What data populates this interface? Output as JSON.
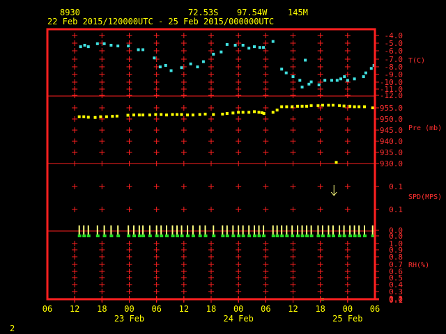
{
  "header": {
    "station": "8930",
    "lat": "72.53S",
    "lon": "97.54W",
    "elev": "145M",
    "period": "22 Feb 2015/120000UTC - 25 Feb 2015/000000UTC"
  },
  "footer": {
    "page": "2"
  },
  "colors": {
    "frame": "#ff2020",
    "label": "#ff3030",
    "text": "#ffff00",
    "temp": "#40e0e0",
    "pres": "#ffff00",
    "rh_line": "#ffff80",
    "rh_dot": "#22dd22",
    "wind": "#ffff80"
  },
  "chart_data": {
    "type": "scatter",
    "x_ticks": [
      "06",
      "12",
      "18",
      "00",
      "06",
      "12",
      "18",
      "00",
      "06",
      "12",
      "18",
      "00",
      "06"
    ],
    "date_labels": [
      "23 Feb",
      "24 Feb",
      "25 Feb"
    ],
    "panels": [
      {
        "name": "T(C)",
        "ticks": [
          "-4.0",
          "-5.0",
          "-6.0",
          "-7.0",
          "-8.0",
          "-9.0",
          "-10.0",
          "-11.0",
          "-12.0"
        ],
        "ylim": [
          -12,
          -4
        ],
        "points": [
          [
            13.3,
            -5.5
          ],
          [
            14.2,
            -5.3
          ],
          [
            15.0,
            -5.5
          ],
          [
            17.0,
            -5.1
          ],
          [
            18.5,
            -5.1
          ],
          [
            20.0,
            -5.3
          ],
          [
            21.5,
            -5.4
          ],
          [
            23.8,
            -5.4
          ],
          [
            26.0,
            -5.9
          ],
          [
            27.0,
            -5.9
          ],
          [
            29.5,
            -7.0
          ],
          [
            30.8,
            -8.2
          ],
          [
            32.0,
            -8.0
          ],
          [
            33.2,
            -8.7
          ],
          [
            35.5,
            -8.3
          ],
          [
            37.5,
            -7.8
          ],
          [
            39.0,
            -8.2
          ],
          [
            40.3,
            -7.5
          ],
          [
            42.5,
            -6.5
          ],
          [
            44.2,
            -6.2
          ],
          [
            45.5,
            -5.2
          ],
          [
            47.3,
            -5.3
          ],
          [
            49.0,
            -5.3
          ],
          [
            50.3,
            -5.7
          ],
          [
            51.5,
            -5.5
          ],
          [
            52.7,
            -5.6
          ],
          [
            53.5,
            -5.6
          ],
          [
            55.6,
            -4.8
          ],
          [
            57.5,
            -8.5
          ],
          [
            58.5,
            -9.0
          ],
          [
            60.0,
            -9.5
          ],
          [
            61.5,
            -10.0
          ],
          [
            62.0,
            -10.9
          ],
          [
            62.7,
            -7.3
          ],
          [
            63.5,
            -10.5
          ],
          [
            64.0,
            -10.2
          ],
          [
            65.7,
            -10.6
          ],
          [
            67.0,
            -10.0
          ],
          [
            68.5,
            -10.0
          ],
          [
            69.7,
            -10.0
          ],
          [
            70.5,
            -9.8
          ],
          [
            71.3,
            -9.5
          ],
          [
            72.0,
            -10.0
          ],
          [
            73.5,
            -9.8
          ],
          [
            75.5,
            -9.5
          ],
          [
            76.0,
            -9.0
          ],
          [
            77.2,
            -8.4
          ],
          [
            77.8,
            -8.0
          ]
        ]
      },
      {
        "name": "Pre (mb)",
        "ticks": [
          "955.0",
          "950.0",
          "945.0",
          "940.0",
          "935.0",
          "930.0"
        ],
        "ylim": [
          930,
          955
        ],
        "points": [
          [
            13.0,
            951.0
          ],
          [
            14.0,
            951.0
          ],
          [
            15.0,
            950.8
          ],
          [
            16.5,
            950.7
          ],
          [
            17.7,
            951.0
          ],
          [
            19.0,
            951.0
          ],
          [
            20.3,
            951.2
          ],
          [
            21.3,
            951.3
          ],
          [
            23.7,
            951.7
          ],
          [
            25.0,
            951.8
          ],
          [
            26.2,
            951.8
          ],
          [
            27.0,
            951.8
          ],
          [
            28.5,
            951.8
          ],
          [
            29.8,
            952.0
          ],
          [
            31.0,
            952.0
          ],
          [
            32.2,
            951.8
          ],
          [
            33.5,
            952.0
          ],
          [
            34.5,
            952.0
          ],
          [
            35.5,
            952.0
          ],
          [
            36.8,
            951.8
          ],
          [
            38.0,
            951.8
          ],
          [
            39.5,
            952.0
          ],
          [
            40.7,
            952.2
          ],
          [
            42.5,
            952.0
          ],
          [
            44.5,
            952.2
          ],
          [
            45.5,
            952.5
          ],
          [
            46.8,
            952.7
          ],
          [
            48.0,
            953.0
          ],
          [
            49.0,
            953.0
          ],
          [
            50.3,
            953.0
          ],
          [
            51.5,
            953.3
          ],
          [
            52.5,
            953.0
          ],
          [
            53.2,
            952.8
          ],
          [
            53.6,
            952.5
          ],
          [
            55.6,
            953.0
          ],
          [
            56.5,
            954.0
          ],
          [
            57.5,
            955.5
          ],
          [
            58.6,
            955.5
          ],
          [
            59.8,
            955.5
          ],
          [
            61.0,
            955.7
          ],
          [
            62.0,
            955.7
          ],
          [
            63.0,
            955.7
          ],
          [
            64.0,
            956.0
          ],
          [
            65.5,
            956.0
          ],
          [
            66.5,
            956.2
          ],
          [
            67.8,
            956.2
          ],
          [
            68.8,
            956.2
          ],
          [
            70.2,
            956.0
          ],
          [
            71.2,
            955.8
          ],
          [
            72.5,
            955.7
          ],
          [
            73.5,
            955.5
          ],
          [
            74.5,
            955.5
          ],
          [
            75.7,
            955.5
          ],
          [
            77.5,
            955.0
          ],
          [
            69.5,
            930.5
          ]
        ]
      },
      {
        "name": "SPD(MPS)",
        "ticks": [
          "0.1",
          "0.1"
        ],
        "wind_arrows": [
          [
            69.0,
            0.1
          ]
        ]
      },
      {
        "name": "RH(%)",
        "ticks": [
          "0.0",
          "0.0",
          "1.0",
          "0.9",
          "0.8",
          "0.7",
          "0.6",
          "0.5",
          "0.4",
          "0.3",
          "0.2",
          "0.1",
          "0.0"
        ],
        "ylim": [
          0,
          1
        ],
        "rh_times": [
          13.0,
          14.0,
          15.0,
          17.0,
          18.5,
          20.0,
          21.5,
          23.8,
          25.0,
          26.2,
          27.0,
          28.5,
          30.0,
          31.0,
          32.2,
          33.5,
          34.5,
          35.5,
          36.8,
          38.0,
          39.5,
          40.7,
          42.5,
          44.5,
          45.5,
          46.8,
          48.0,
          49.0,
          50.3,
          51.5,
          52.5,
          53.5,
          55.6,
          56.5,
          57.5,
          58.6,
          59.8,
          61.0,
          62.0,
          63.0,
          64.0,
          65.5,
          66.5,
          67.8,
          68.8,
          70.2,
          71.2,
          72.5,
          73.5,
          74.5,
          75.7,
          77.5
        ],
        "rh_values": [
          1.0,
          1.0,
          1.0,
          1.0,
          1.0,
          1.0,
          1.0,
          1.0,
          1.0,
          1.0,
          1.0,
          1.0,
          1.0,
          1.0,
          1.0,
          1.0,
          1.0,
          1.0,
          1.0,
          1.0,
          1.0,
          1.0,
          1.0,
          1.0,
          1.0,
          1.0,
          1.0,
          1.0,
          1.0,
          1.0,
          1.0,
          1.0,
          1.0,
          1.0,
          1.0,
          1.0,
          1.0,
          1.0,
          1.0,
          1.0,
          1.0,
          1.0,
          1.0,
          1.0,
          1.0,
          1.0,
          1.0,
          1.0,
          1.0,
          1.0,
          1.0,
          1.0
        ],
        "outlier": [
          66.5,
          0.0
        ]
      }
    ]
  }
}
